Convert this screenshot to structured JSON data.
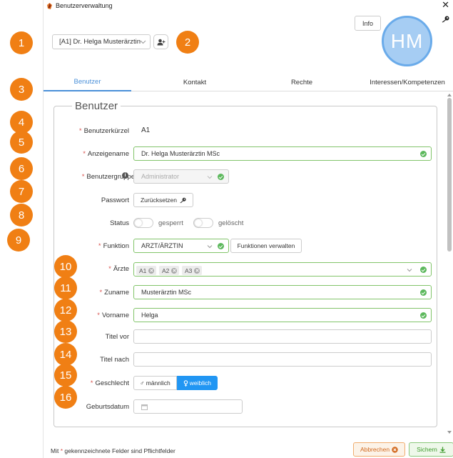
{
  "window": {
    "title": "Benutzerverwaltung"
  },
  "header": {
    "selected_user": "[A1] Dr. Helga Musterärztin",
    "info_label": "Info",
    "avatar_initials": "HM"
  },
  "tabs": [
    {
      "label": "Benutzer"
    },
    {
      "label": "Kontakt"
    },
    {
      "label": "Rechte"
    },
    {
      "label": "Interessen/Kompetenzen"
    }
  ],
  "section": {
    "legend": "Benutzer"
  },
  "fields": {
    "kuerzel": {
      "label": "Benutzerkürzel",
      "required": "*",
      "value": "A1"
    },
    "anzeigename": {
      "label": "Anzeigename",
      "required": "*",
      "value": "Dr. Helga Musterärztin MSc"
    },
    "gruppe": {
      "label": "Benutzergruppe",
      "required": "*",
      "value": "Administrator"
    },
    "passwort": {
      "label": "Passwort",
      "button": "Zurücksetzen"
    },
    "status": {
      "label": "Status",
      "toggle1": "gesperrt",
      "toggle2": "gelöscht"
    },
    "funktion": {
      "label": "Funktion",
      "required": "*",
      "value": "ARZT/ÄRZTIN",
      "button": "Funktionen verwalten"
    },
    "aerzte": {
      "label": "Ärzte",
      "required": "*",
      "chips": [
        "A1",
        "A2",
        "A3"
      ]
    },
    "zuname": {
      "label": "Zuname",
      "required": "*",
      "value": "Musterärztin MSc"
    },
    "vorname": {
      "label": "Vorname",
      "required": "*",
      "value": "Helga"
    },
    "titel_vor": {
      "label": "Titel vor",
      "value": ""
    },
    "titel_nach": {
      "label": "Titel nach",
      "value": ""
    },
    "geschlecht": {
      "label": "Geschlecht",
      "required": "*",
      "male": "♂ männlich",
      "female": "weiblich"
    },
    "geburtsdatum": {
      "label": "Geburtsdatum",
      "value": ""
    }
  },
  "footer": {
    "note_prefix": "Mit",
    "note_star": "*",
    "note_suffix": "gekennzeichnete Felder sind Pflichtfelder",
    "cancel": "Abbrechen",
    "save": "Sichern"
  },
  "badges": [
    "1",
    "2",
    "3",
    "4",
    "5",
    "6",
    "7",
    "8",
    "9",
    "10",
    "11",
    "12",
    "13",
    "14",
    "15",
    "16"
  ],
  "colors": {
    "accent": "#2196f3",
    "badge": "#f07f14",
    "valid": "#5cb85c",
    "required": "#d9534f"
  }
}
